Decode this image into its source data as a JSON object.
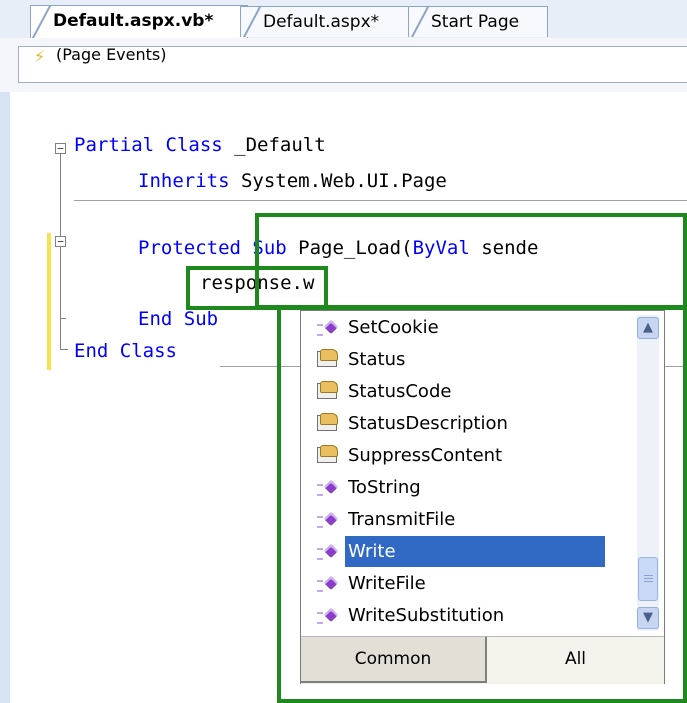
{
  "tabs": [
    {
      "label": "Default.aspx.vb*",
      "active": true
    },
    {
      "label": "Default.aspx*",
      "active": false
    },
    {
      "label": "Start Page",
      "active": false
    }
  ],
  "nav": {
    "events_label": "(Page Events)",
    "icon": "lightning-icon"
  },
  "code": {
    "line1_kw": "Partial Class",
    "line1_rest": " _Default",
    "line2_kw": "Inherits",
    "line2_rest": " System.Web.UI.Page",
    "line3_kw1": "Protected Sub",
    "line3_mid": " Page_Load(",
    "line3_kw2": "ByVal",
    "line3_rest": " sende",
    "line4": "response.w",
    "line5_kw": "End Sub",
    "line6_kw": "End Class"
  },
  "completion": {
    "items": [
      {
        "label": "SetCookie",
        "icon": "method-icon"
      },
      {
        "label": "Status",
        "icon": "property-icon"
      },
      {
        "label": "StatusCode",
        "icon": "property-icon"
      },
      {
        "label": "StatusDescription",
        "icon": "property-icon"
      },
      {
        "label": "SuppressContent",
        "icon": "property-icon"
      },
      {
        "label": "ToString",
        "icon": "method-icon"
      },
      {
        "label": "TransmitFile",
        "icon": "method-icon"
      },
      {
        "label": "Write",
        "icon": "method-icon",
        "selected": true
      },
      {
        "label": "WriteFile",
        "icon": "method-icon"
      },
      {
        "label": "WriteSubstitution",
        "icon": "method-icon"
      }
    ],
    "tabs": {
      "common": "Common",
      "all": "All"
    }
  },
  "colors": {
    "keyword": "#0000ff",
    "highlight_box": "#1e8a1e",
    "selection": "#316ac5"
  }
}
